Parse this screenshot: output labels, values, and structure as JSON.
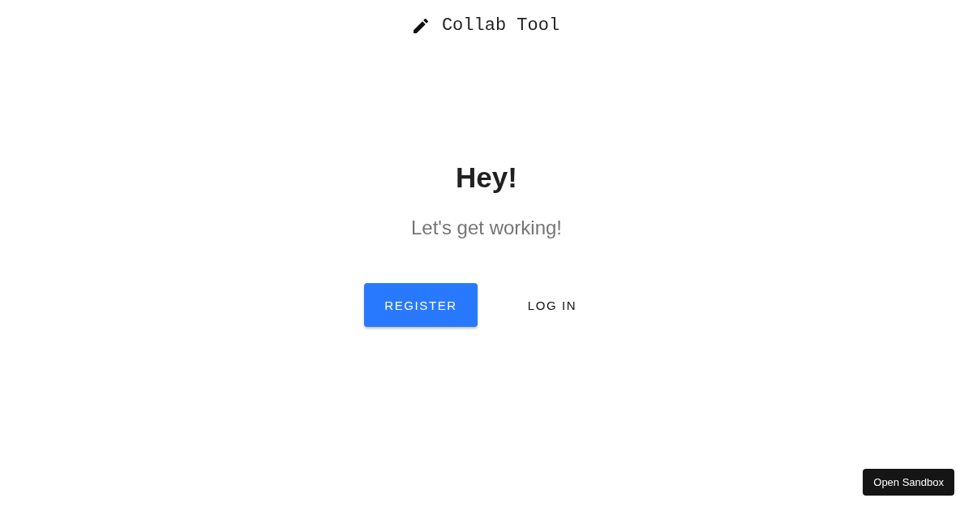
{
  "header": {
    "title": "Collab Tool"
  },
  "hero": {
    "heading": "Hey!",
    "subtitle": "Let's get working!"
  },
  "buttons": [
    {
      "label": "REGISTER",
      "kind": "primary"
    },
    {
      "label": "LOG IN",
      "kind": "text"
    }
  ],
  "sandbox_button": {
    "label": "Open Sandbox"
  }
}
